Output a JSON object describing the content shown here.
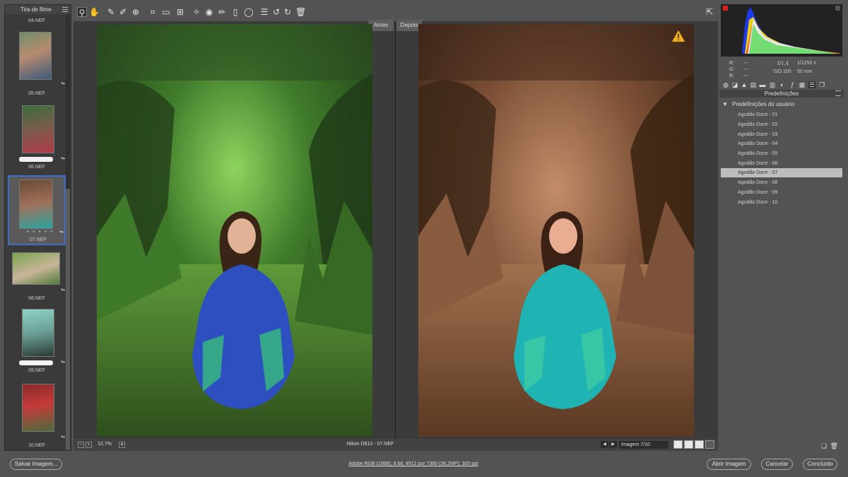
{
  "filmstrip": {
    "title": "Tira de filme",
    "items": [
      {
        "name": "04.NEF"
      },
      {
        "name": "05.NEF"
      },
      {
        "name": "06.NEF"
      },
      {
        "name": "07.NEF",
        "selected": true,
        "rating": "• • • • •"
      },
      {
        "name": "08.NEF"
      },
      {
        "name": "09.NEF"
      },
      {
        "name": "10.NEF"
      }
    ]
  },
  "compare": {
    "before_label": "Antes",
    "after_label": "Depois"
  },
  "preview_footer": {
    "zoom": "12,7%",
    "camera_file": "Nikon D810  -  07.NEF",
    "image_counter": "Imagem 7/10"
  },
  "readout": {
    "r_label": "R:",
    "g_label": "G:",
    "b_label": "B:",
    "r_value": "---",
    "g_value": "---",
    "b_value": "---",
    "aperture": "f/1,4",
    "shutter": "1/1250 s",
    "iso": "ISO 100",
    "focal": "50 mm"
  },
  "presets": {
    "panel_title": "Predefinições",
    "group_label": "Predefinições do usuário",
    "items": [
      "Agodão Doce - 01",
      "Agodão Doce - 02",
      "Agodão Doce - 03",
      "Agodão Doce - 04",
      "Agodão Doce - 05",
      "Agodão Doce - 06",
      "Agodão Doce - 07",
      "Agodão Doce - 08",
      "Agodão Doce - 09",
      "Agodão Doce - 10"
    ],
    "selected_index": 6
  },
  "bottom": {
    "save_label": "Salvar Imagem...",
    "workflow": "Adobe RGB (1998); 8 bit; 4912 por 7360 (36,2MP); 300 ppi",
    "open_label": "Abrir Imagem",
    "cancel_label": "Cancelar",
    "done_label": "Concluído"
  },
  "colors": {
    "accent": "#3d6fc8",
    "warning": "#f2b01e"
  }
}
